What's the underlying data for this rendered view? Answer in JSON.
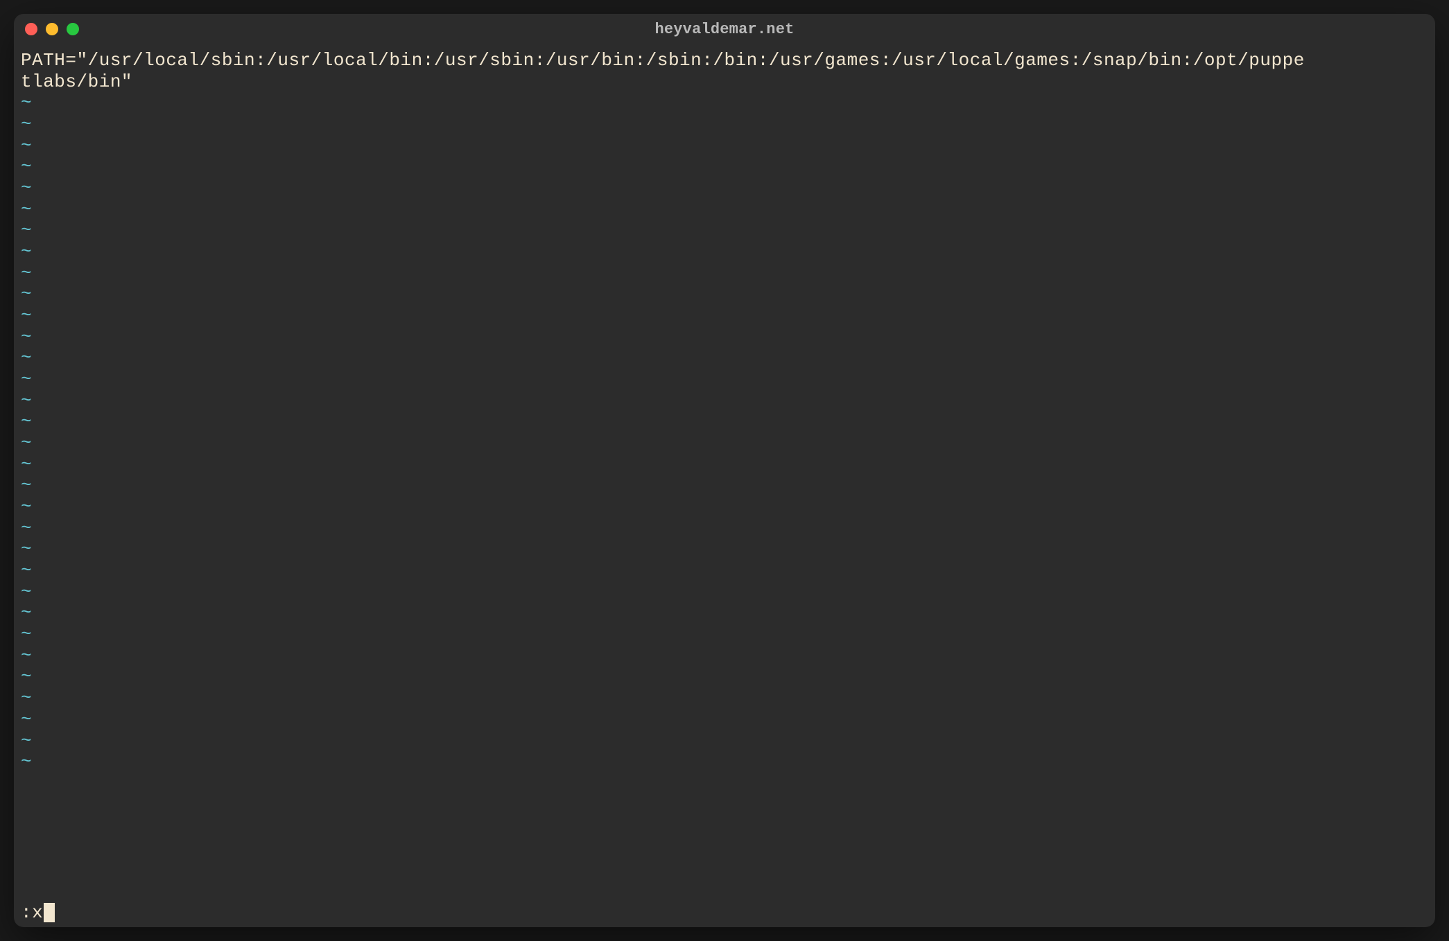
{
  "window": {
    "title": "heyvaldemar.net"
  },
  "editor": {
    "content_line1": "PATH=\"/usr/local/sbin:/usr/local/bin:/usr/sbin:/usr/bin:/sbin:/bin:/usr/games:/usr/local/games:/snap/bin:/opt/puppe",
    "content_line2": "tlabs/bin\"",
    "tilde_char": "~",
    "tilde_count": 32,
    "command": ":x"
  },
  "colors": {
    "window_bg": "#2c2c2c",
    "text": "#f2e6cf",
    "tilde": "#64c6d4",
    "title": "#b9b9b9",
    "close": "#ff5f57",
    "minimize": "#febc2e",
    "maximize": "#28c840"
  }
}
